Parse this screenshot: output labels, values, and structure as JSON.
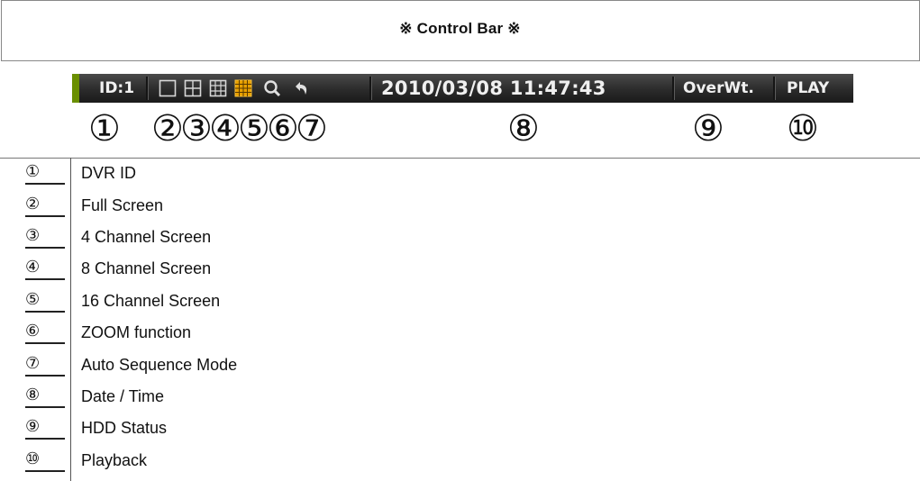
{
  "title": "※ Control Bar ※",
  "control_bar": {
    "id_label": "ID:1",
    "icons": [
      "full-screen-icon",
      "four-channel-icon",
      "eight-channel-icon",
      "sixteen-channel-icon",
      "zoom-icon",
      "auto-sequence-icon"
    ],
    "datetime": "2010/03/08 11:47:43",
    "hdd_status": "OverWt.",
    "play_label": "PLAY",
    "accent_color": "#6a8f00",
    "active_icon_color": "#e8a000"
  },
  "callouts": [
    "①",
    "②",
    "③",
    "④",
    "⑤",
    "⑥",
    "⑦",
    "⑧",
    "⑨",
    "⑩"
  ],
  "legend": [
    {
      "num": "①",
      "text": "DVR ID"
    },
    {
      "num": "②",
      "text": "Full Screen"
    },
    {
      "num": "③",
      "text": "4 Channel Screen"
    },
    {
      "num": "④",
      "text": "8 Channel Screen"
    },
    {
      "num": "⑤",
      "text": "16 Channel Screen"
    },
    {
      "num": "⑥",
      "text": "ZOOM function"
    },
    {
      "num": "⑦",
      "text": "Auto Sequence Mode"
    },
    {
      "num": "⑧",
      "text": "Date / Time"
    },
    {
      "num": "⑨",
      "text": "HDD Status"
    },
    {
      "num": "⑩",
      "text": "Playback"
    }
  ]
}
